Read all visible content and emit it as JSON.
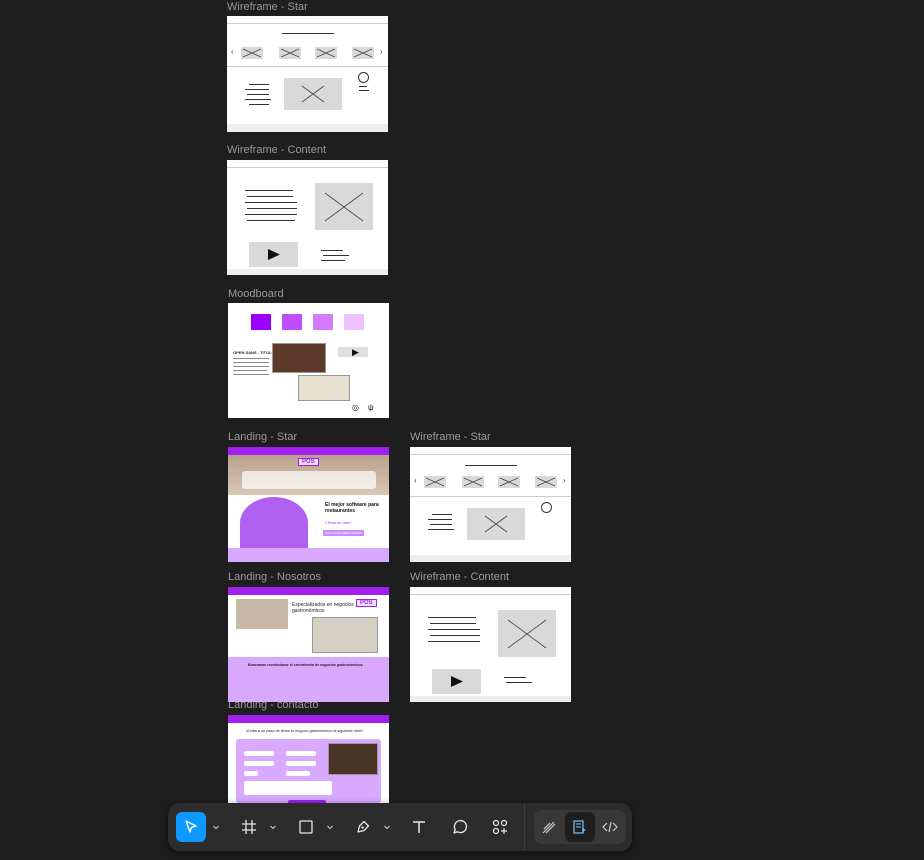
{
  "canvas": {
    "frames": [
      {
        "id": "wf-star-1",
        "label": "Wireframe - Star"
      },
      {
        "id": "wf-content-1",
        "label": "Wireframe - Content"
      },
      {
        "id": "moodboard",
        "label": "Moodboard"
      },
      {
        "id": "landing-star",
        "label": "Landing - Star"
      },
      {
        "id": "wf-star-2",
        "label": "Wireframe - Star"
      },
      {
        "id": "landing-nosotros",
        "label": "Landing - Nosotros"
      },
      {
        "id": "wf-content-2",
        "label": "Wireframe - Content"
      },
      {
        "id": "landing-contacto",
        "label": "Landing - contacto"
      }
    ]
  },
  "landing_star": {
    "badge": "POS",
    "headline": "El mejor software para restaurantes",
    "tagline": "«Todo en uno»",
    "cta": "SOLICITAR DEMO GRATIS"
  },
  "landing_nosotros": {
    "badge": "POS",
    "headline": "Especializados en negocios gastronómicos",
    "banner": "Buscamos revolucionar el crecimiento de negocios gastronómicos"
  },
  "landing_contacto": {
    "headline": "¡Estás a un paso de llevar tu negocio gastronómico al siguiente nivel!"
  },
  "moodboard": {
    "title": "OPEN SANS - TITULO",
    "swatches": [
      "#9b00ff",
      "#c04dff",
      "#d27bff",
      "#ebc2ff"
    ]
  },
  "toolbar": {
    "tools": [
      {
        "name": "move-tool",
        "icon": "cursor-icon",
        "active": true
      },
      {
        "name": "frame-tool",
        "icon": "frame-icon"
      },
      {
        "name": "shape-tool",
        "icon": "rectangle-icon"
      },
      {
        "name": "pen-tool",
        "icon": "pen-icon"
      },
      {
        "name": "text-tool",
        "icon": "text-icon"
      },
      {
        "name": "comment-tool",
        "icon": "comment-icon"
      },
      {
        "name": "actions-tool",
        "icon": "components-icon"
      },
      {
        "name": "draw-mode",
        "icon": "draw-icon"
      },
      {
        "name": "design-mode",
        "icon": "design-mode-icon",
        "active": true
      },
      {
        "name": "dev-mode",
        "icon": "code-icon"
      }
    ],
    "accent": "#0d99ff"
  }
}
